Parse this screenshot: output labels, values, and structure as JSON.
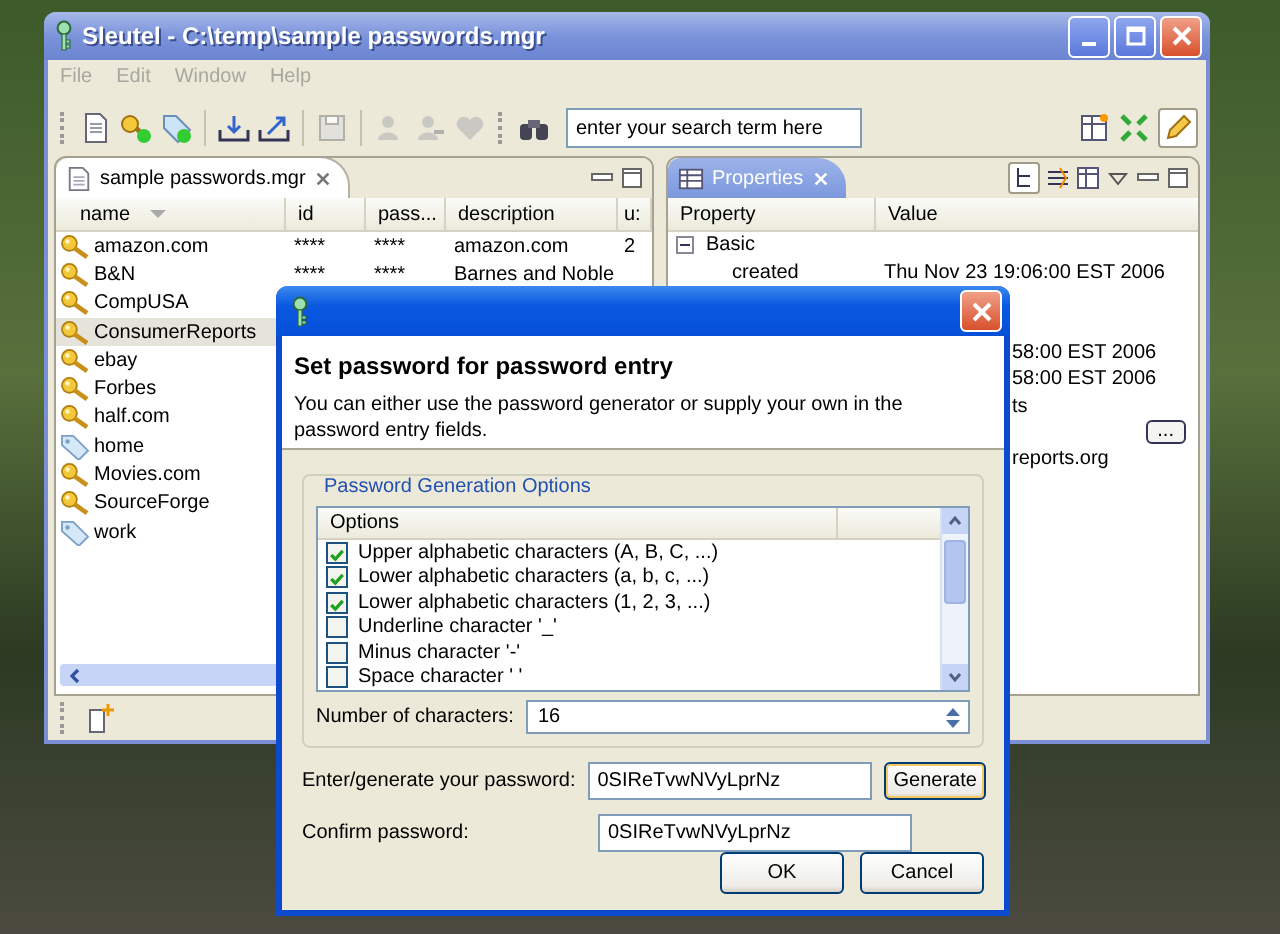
{
  "window": {
    "title": "Sleutel - C:\\temp\\sample passwords.mgr"
  },
  "menu": [
    "File",
    "Edit",
    "Window",
    "Help"
  ],
  "toolbar": {
    "search": {
      "placeholder": "enter your search term here"
    }
  },
  "editor": {
    "tab": {
      "label": "sample passwords.mgr",
      "selected": true
    },
    "columns": [
      "name",
      "id",
      "pass...",
      "description",
      "u:"
    ],
    "rows": [
      {
        "kind": "key",
        "name": "amazon.com",
        "selected": false,
        "cells": [
          "****",
          "****",
          "amazon.com",
          "2"
        ]
      },
      {
        "kind": "key",
        "name": "B&N",
        "selected": false,
        "cells": [
          "****",
          "****",
          "Barnes and Noble"
        ]
      },
      {
        "kind": "key",
        "name": "CompUSA",
        "selected": false
      },
      {
        "kind": "key",
        "name": "ConsumerReports",
        "selected": true
      },
      {
        "kind": "key",
        "name": "ebay",
        "selected": false
      },
      {
        "kind": "key",
        "name": "Forbes",
        "selected": false
      },
      {
        "kind": "key",
        "name": "half.com",
        "selected": false
      },
      {
        "kind": "tag",
        "name": "home",
        "selected": false
      },
      {
        "kind": "key",
        "name": "Movies.com",
        "selected": false
      },
      {
        "kind": "key",
        "name": "SourceForge",
        "selected": false
      },
      {
        "kind": "tag",
        "name": "work",
        "selected": false
      }
    ]
  },
  "properties": {
    "tab": {
      "label": "Properties",
      "selected": true
    },
    "columns": [
      "Property",
      "Value"
    ],
    "rows": [
      {
        "kind": "group",
        "property": "Basic",
        "expanded": true
      },
      {
        "kind": "field",
        "property": "created",
        "value": "Thu Nov 23 19:06:00 EST 2006"
      },
      {
        "kind": "covered"
      },
      {
        "kind": "covered"
      },
      {
        "kind": "covered",
        "value": "58:00 EST 2006"
      },
      {
        "kind": "covered",
        "value": "58:00 EST 2006"
      },
      {
        "kind": "covered",
        "value": "ts"
      },
      {
        "kind": "button",
        "label": "..."
      },
      {
        "kind": "covered",
        "value": "reports.org"
      }
    ]
  },
  "dialog": {
    "title": "Set password for password entry",
    "description": "You can either use the password generator or supply your own in the password entry fields.",
    "group": "Password Generation Options",
    "options_column": "Options",
    "options": [
      {
        "label": "Upper alphabetic characters (A, B, C, ...)",
        "checked": true
      },
      {
        "label": "Lower alphabetic characters (a, b, c, ...)",
        "checked": true
      },
      {
        "label": "Lower alphabetic characters (1, 2, 3, ...)",
        "checked": true
      },
      {
        "label": "Underline character '_'",
        "checked": false
      },
      {
        "label": "Minus character '-'",
        "checked": false
      },
      {
        "label": "Space character ' '",
        "checked": false
      }
    ],
    "count_label": "Number of characters:",
    "count_value": "16",
    "password_label": "Enter/generate your password:",
    "password_value": "0SIReTvwNVyLprNz",
    "generate": "Generate",
    "confirm_label": "Confirm password:",
    "confirm_value": "0SIReTvwNVyLprNz",
    "buttons": [
      "OK",
      "Cancel"
    ]
  }
}
